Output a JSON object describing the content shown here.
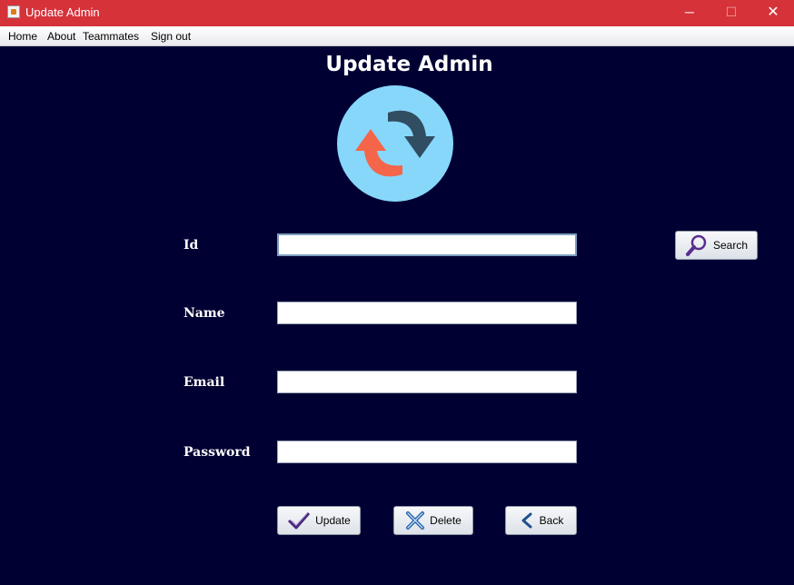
{
  "window": {
    "title": "Update Admin",
    "app_icon": "java-icon",
    "controls": {
      "minimize": "─",
      "maximize": "☐",
      "close": "✕"
    }
  },
  "menu": {
    "items": [
      "Home",
      "About",
      "Teammates",
      "Sign out"
    ]
  },
  "page": {
    "heading": "Update Admin",
    "logo_icon": "refresh-arrows-icon"
  },
  "form": {
    "id_label": "Id",
    "id_value": "",
    "name_label": "Name",
    "name_value": "",
    "email_label": "Email",
    "email_value": "",
    "password_label": "Password",
    "password_value": ""
  },
  "buttons": {
    "search": "Search",
    "update": "Update",
    "delete": "Delete",
    "back": "Back"
  },
  "colors": {
    "titlebar": "#d6323a",
    "background": "#000033",
    "logo_circle": "#87d7fb",
    "arrow_orange": "#f4654a",
    "arrow_dark": "#314d62"
  }
}
